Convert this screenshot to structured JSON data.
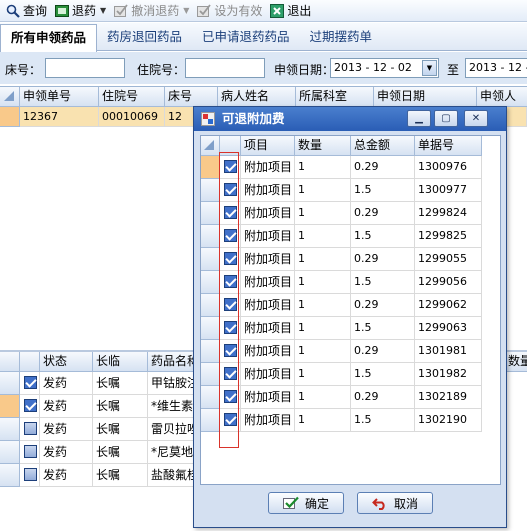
{
  "toolbar": {
    "query": "查询",
    "return_drug": "退药",
    "cancel_return": "撤消退药",
    "set_valid": "设为有效",
    "exit": "退出"
  },
  "tabs": [
    "所有申领药品",
    "药房退回药品",
    "已申请退药药品",
    "过期摆药单"
  ],
  "filter": {
    "bed_label": "床号：",
    "admission_label": "住院号：",
    "date_label": "申领日期：",
    "date_from": "2013 - 12 - 02",
    "to_label": "至",
    "date_to": "2013 - 12 -"
  },
  "top_grid": {
    "headers": [
      "申领单号",
      "住院号",
      "床号",
      "病人姓名",
      "所属科室",
      "申领日期",
      "申领人"
    ],
    "rows": [
      [
        "12367",
        "00010069",
        "12",
        "",
        "",
        "",
        ""
      ]
    ]
  },
  "bottom_grid": {
    "headers": [
      "状态",
      "长临",
      "药品名称",
      "数量"
    ],
    "rows": [
      {
        "checked": true,
        "status": "发药",
        "type": "长嘱",
        "drug": "甲钴胺注"
      },
      {
        "checked": true,
        "status": "发药",
        "type": "长嘱",
        "drug": "*维生素"
      },
      {
        "checked": false,
        "status": "发药",
        "type": "长嘱",
        "drug": "雷贝拉唑"
      },
      {
        "checked": false,
        "status": "发药",
        "type": "长嘱",
        "drug": "*尼莫地"
      },
      {
        "checked": false,
        "status": "发药",
        "type": "长嘱",
        "drug": "盐酸氟桂"
      }
    ]
  },
  "dialog": {
    "title": "可退附加费",
    "headers": [
      "项目",
      "数量",
      "总金额",
      "单据号"
    ],
    "rows": [
      {
        "item": "附加项目",
        "qty": "1",
        "amount": "0.29",
        "doc_no": "1300976"
      },
      {
        "item": "附加项目",
        "qty": "1",
        "amount": "1.5",
        "doc_no": "1300977"
      },
      {
        "item": "附加项目",
        "qty": "1",
        "amount": "0.29",
        "doc_no": "1299824"
      },
      {
        "item": "附加项目",
        "qty": "1",
        "amount": "1.5",
        "doc_no": "1299825"
      },
      {
        "item": "附加项目",
        "qty": "1",
        "amount": "0.29",
        "doc_no": "1299055"
      },
      {
        "item": "附加项目",
        "qty": "1",
        "amount": "1.5",
        "doc_no": "1299056"
      },
      {
        "item": "附加项目",
        "qty": "1",
        "amount": "0.29",
        "doc_no": "1299062"
      },
      {
        "item": "附加项目",
        "qty": "1",
        "amount": "1.5",
        "doc_no": "1299063"
      },
      {
        "item": "附加项目",
        "qty": "1",
        "amount": "0.29",
        "doc_no": "1301981"
      },
      {
        "item": "附加项目",
        "qty": "1",
        "amount": "1.5",
        "doc_no": "1301982"
      },
      {
        "item": "附加项目",
        "qty": "1",
        "amount": "0.29",
        "doc_no": "1302189"
      },
      {
        "item": "附加项目",
        "qty": "1",
        "amount": "1.5",
        "doc_no": "1302190"
      }
    ],
    "ok_label": "确定",
    "cancel_label": "取消"
  },
  "colors": {
    "selected_row": "#f9e2b0",
    "title_bar": "#2a5db5",
    "highlight_box": "#d9332b"
  }
}
